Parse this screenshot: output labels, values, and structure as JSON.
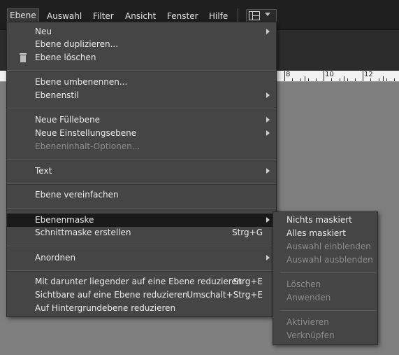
{
  "menubar": {
    "items": [
      "Ebene",
      "Auswahl",
      "Filter",
      "Ansicht",
      "Fenster",
      "Hilfe"
    ]
  },
  "ruler": {
    "labels": [
      "8",
      "10",
      "12"
    ]
  },
  "menu": {
    "neu": "Neu",
    "duplizieren": "Ebene duplizieren...",
    "loeschen": "Ebene löschen",
    "umbenennen": "Ebene umbenennen...",
    "ebenenstil": "Ebenenstil",
    "fuellebene": "Neue Füllebene",
    "einstellungsebene": "Neue Einstellungsebene",
    "ebeneninhalt": "Ebeneninhalt-Optionen...",
    "text": "Text",
    "vereinfachen": "Ebene vereinfachen",
    "ebenenmaske": "Ebenenmaske",
    "schnittmaske": "Schnittmaske erstellen",
    "schnittmaske_shortcut": "Strg+G",
    "anordnen": "Anordnen",
    "reduzieren_darunter": "Mit darunter liegender auf eine Ebene reduzieren",
    "reduzieren_darunter_shortcut": "Strg+E",
    "sichtbare": "Sichtbare auf eine Ebene reduzieren",
    "sichtbare_shortcut": "Umschalt+Strg+E",
    "hintergrund": "Auf Hintergrundebene reduzieren"
  },
  "submenu": {
    "nichts": "Nichts maskiert",
    "alles": "Alles maskiert",
    "einblenden": "Auswahl einblenden",
    "ausblenden": "Auswahl ausblenden",
    "loeschen": "Löschen",
    "anwenden": "Anwenden",
    "aktivieren": "Aktivieren",
    "verknuepfen": "Verknüpfen"
  }
}
